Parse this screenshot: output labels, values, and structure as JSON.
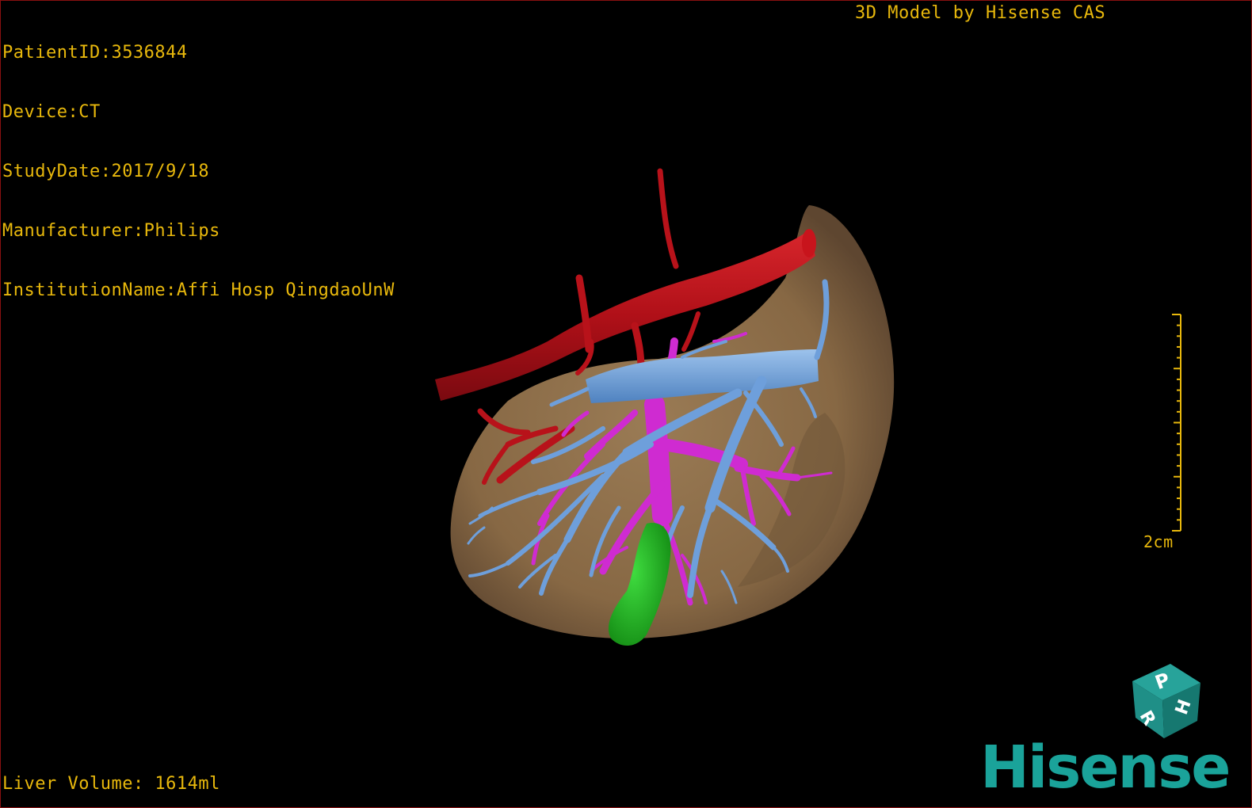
{
  "overlay": {
    "patient_id": "PatientID:3536844",
    "device": "Device:CT",
    "study_date": "StudyDate:2017/9/18",
    "manufacturer": "Manufacturer:Philips",
    "institution": "InstitutionName:Affi Hosp QingdaoUnW",
    "model_credit": "3D Model by Hisense CAS",
    "liver_volume": "Liver Volume: 1614ml",
    "scale_label": "2cm"
  },
  "orientation_cube": {
    "face_top": "P",
    "face_right": "H",
    "face_left": "R"
  },
  "brand": {
    "logo_text": "Hisense",
    "logo_color": "#1aa39a"
  },
  "colors": {
    "overlay_text": "#e8b80c",
    "liver": "#8b6d4a",
    "artery": "#c0141c",
    "portal_vein": "#d22ad4",
    "hepatic_vein": "#6ea0dc",
    "gallbladder": "#1fb41f",
    "frame_border": "#8a1010"
  }
}
